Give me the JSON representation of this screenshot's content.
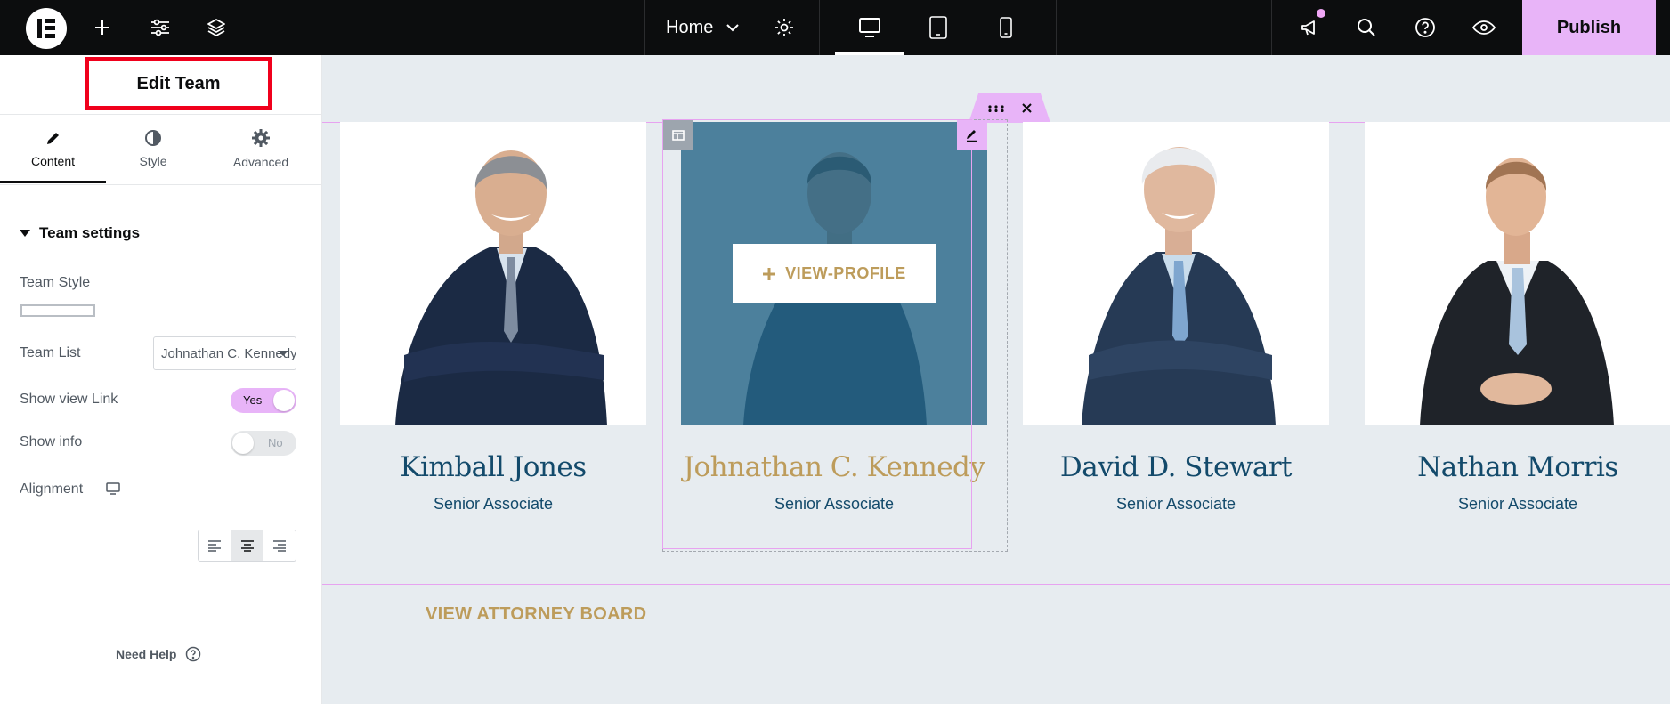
{
  "topbar": {
    "page_name": "Home",
    "publish_label": "Publish",
    "icons": [
      "elementor-logo-icon",
      "add-icon",
      "sliders-icon",
      "layers-icon",
      "chevron-down-icon",
      "gear-icon",
      "desktop-icon",
      "tablet-icon",
      "mobile-icon",
      "megaphone-icon",
      "search-icon",
      "help-icon",
      "eye-icon"
    ],
    "colors": {
      "bg": "#0c0d0e",
      "publish_bg": "#e8b4f8"
    }
  },
  "panel": {
    "title": "Edit Team",
    "tabs": [
      {
        "label": "Content",
        "icon": "pencil-icon",
        "active": true
      },
      {
        "label": "Style",
        "icon": "half-circle-icon",
        "active": false
      },
      {
        "label": "Advanced",
        "icon": "gear-icon",
        "active": false
      }
    ],
    "section_title": "Team settings",
    "controls": {
      "team_style_label": "Team Style",
      "team_list_label": "Team List",
      "team_list_value": "Johnathan C. Kennedy",
      "show_view_link_label": "Show view Link",
      "show_view_link_value": "Yes",
      "show_info_label": "Show info",
      "show_info_value": "No",
      "alignment_label": "Alignment",
      "alignment_value": "center"
    },
    "need_help": "Need Help"
  },
  "canvas": {
    "view_profile_label": "VIEW-PROFILE",
    "board_link": "VIEW ATTORNEY BOARD",
    "team": [
      {
        "name": "Kimball Jones",
        "role": "Senior Associate"
      },
      {
        "name": "Johnathan C. Kennedy",
        "role": "Senior Associate"
      },
      {
        "name": "David D. Stewart",
        "role": "Senior Associate"
      },
      {
        "name": "Nathan Morris",
        "role": "Senior Associate"
      }
    ],
    "colors": {
      "name": "#134a6b",
      "accent": "#bd9c5b",
      "overlay": "#256486"
    }
  }
}
